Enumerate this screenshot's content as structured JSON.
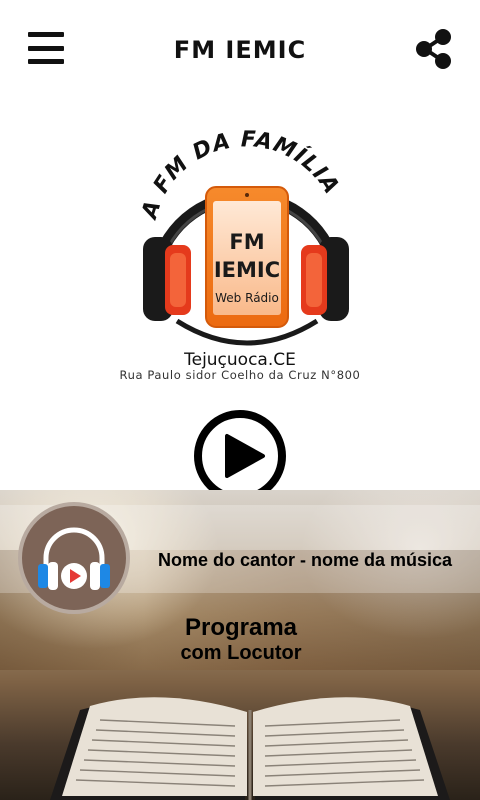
{
  "header": {
    "title": "FM IEMIC"
  },
  "logo": {
    "arc_text": "A FM DA FAMÍLIA",
    "name_line1": "FM",
    "name_line2": "IEMIC",
    "subtitle": "Web Rádio",
    "city": "Tejuçuoca.CE",
    "address": "Rua Paulo sidor Coelho da Cruz N°800"
  },
  "player": {
    "song": "Nome do cantor - nome da música",
    "program_line1": "Programa",
    "program_line2": "com Locutor"
  },
  "colors": {
    "accent_orange": "#f47a1f",
    "headphone_red": "#e53a1c",
    "avatar_bg": "#7d6457",
    "icon_blue": "#1e88e5",
    "play_red": "#e53935"
  },
  "icons": {
    "menu": "menu-icon",
    "share": "share-icon",
    "play": "play-icon",
    "radio": "headphones-icon"
  }
}
